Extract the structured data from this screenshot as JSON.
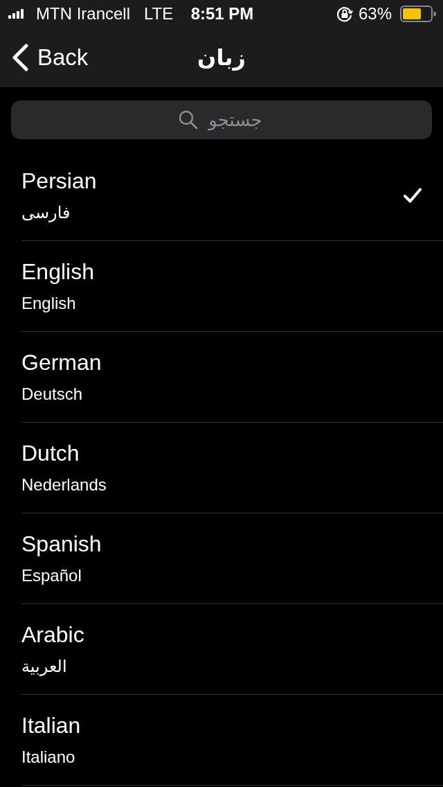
{
  "status_bar": {
    "carrier": "MTN Irancell",
    "network": "LTE",
    "time": "8:51 PM",
    "battery": "63%"
  },
  "nav_bar": {
    "back_label": "Back",
    "title": "زبان"
  },
  "search": {
    "placeholder": "جستجو"
  },
  "languages": [
    {
      "name": "Persian",
      "native_name": "فارسی",
      "selected": true
    },
    {
      "name": "English",
      "native_name": "English",
      "selected": false
    },
    {
      "name": "German",
      "native_name": "Deutsch",
      "selected": false
    },
    {
      "name": "Dutch",
      "native_name": "Nederlands",
      "selected": false
    },
    {
      "name": "Spanish",
      "native_name": "Español",
      "selected": false
    },
    {
      "name": "Arabic",
      "native_name": "العربية",
      "selected": false
    },
    {
      "name": "Italian",
      "native_name": "Italiano",
      "selected": false
    }
  ]
}
